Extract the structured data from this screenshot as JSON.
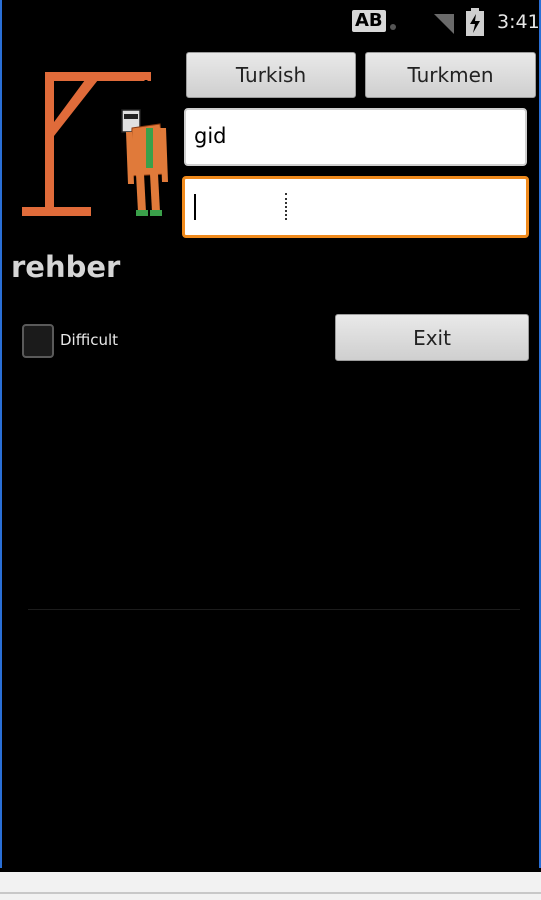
{
  "status_bar": {
    "ab_badge": "AB",
    "time": "3:41",
    "icons": [
      "ab-notification-icon",
      "signal-icon",
      "battery-charging-icon"
    ]
  },
  "language_buttons": {
    "turkish_label": "Turkish",
    "turkmen_label": "Turkmen"
  },
  "word_field": {
    "value": "gid"
  },
  "guess_field": {
    "value": "",
    "accent_color": "#f08a1c"
  },
  "answer_text": "rehber",
  "difficult_checkbox": {
    "label": "Difficult",
    "checked": false
  },
  "exit_button": {
    "label": "Exit"
  },
  "hangman_image": {
    "icon": "hangman-gallows-icon",
    "gallows_color": "#e06b3a"
  }
}
